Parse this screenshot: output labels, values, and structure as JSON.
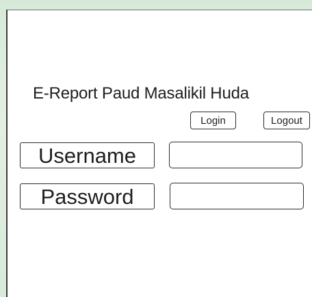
{
  "app": {
    "title": "E-Report Paud Masalikil Huda"
  },
  "auth_buttons": {
    "login_label": "Login",
    "logout_label": "Logout"
  },
  "form": {
    "username": {
      "label": "Username",
      "value": "",
      "placeholder": ""
    },
    "password": {
      "label": "Password",
      "value": "",
      "placeholder": ""
    }
  },
  "colors": {
    "background": "#dcece0",
    "panel": "#ffffff",
    "border": "#2a2a2a"
  }
}
